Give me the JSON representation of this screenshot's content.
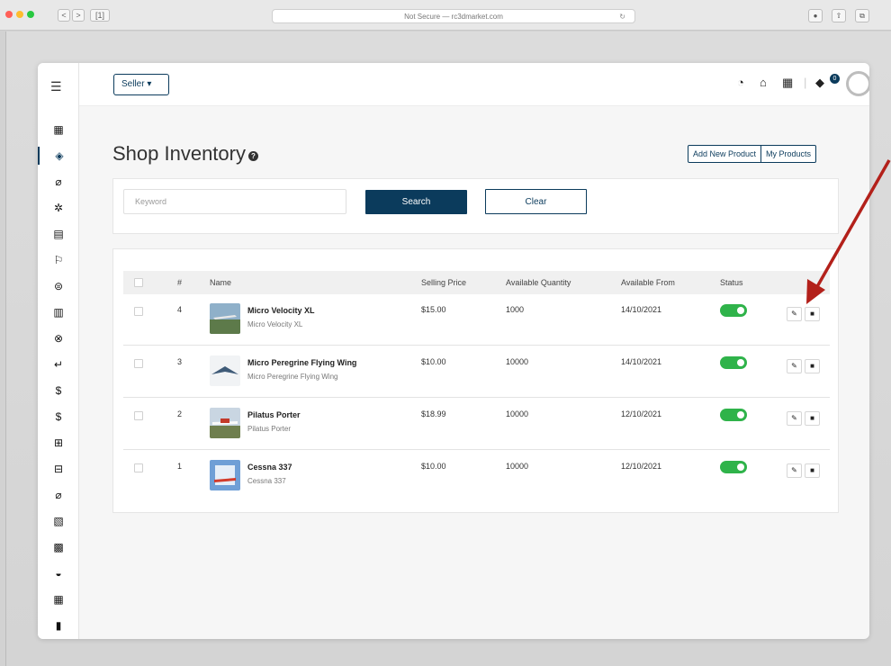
{
  "browser": {
    "url_text": "Not Secure — rc3dmarket.com",
    "nav_back": "<",
    "nav_forward": ">",
    "tab_icon": "[1]"
  },
  "topbar": {
    "seller_label": "Seller ▾",
    "notification_count": "0"
  },
  "page": {
    "title": "Shop Inventory",
    "add_new_product": "Add New Product",
    "my_products": "My Products"
  },
  "search": {
    "placeholder": "Keyword",
    "search_label": "Search",
    "clear_label": "Clear"
  },
  "table": {
    "columns": [
      "#",
      "Name",
      "Selling Price",
      "Available Quantity",
      "Available From",
      "Status"
    ],
    "rows": [
      {
        "num": "4",
        "name": "Micro Velocity XL",
        "sub": "Micro Velocity XL",
        "price": "$15.00",
        "qty": "1000",
        "from": "14/10/2021",
        "status": "on"
      },
      {
        "num": "3",
        "name": "Micro Peregrine Flying Wing",
        "sub": "Micro Peregrine Flying Wing",
        "price": "$10.00",
        "qty": "10000",
        "from": "14/10/2021",
        "status": "on"
      },
      {
        "num": "2",
        "name": "Pilatus Porter",
        "sub": "Pilatus Porter",
        "price": "$18.99",
        "qty": "10000",
        "from": "12/10/2021",
        "status": "on"
      },
      {
        "num": "1",
        "name": "Cessna 337",
        "sub": "Cessna 337",
        "price": "$10.00",
        "qty": "10000",
        "from": "12/10/2021",
        "status": "on"
      }
    ]
  },
  "colors": {
    "brand": "#0b3b5c",
    "toggle_on": "#2fb34a",
    "annotation_arrow": "#b3201a"
  },
  "icons": {
    "sidebar": [
      "store-icon",
      "box-icon",
      "tag-icon",
      "gear-icon",
      "server-icon",
      "sign-icon",
      "car-icon",
      "bar-chart-icon",
      "close-circle-icon",
      "return-icon",
      "dollar-icon",
      "dollar-alt-icon",
      "sitemap-icon",
      "network-icon",
      "tag-alt-icon",
      "invoice-icon",
      "calculator-icon",
      "dashboard-icon",
      "building-icon",
      "clipboard-icon"
    ]
  }
}
